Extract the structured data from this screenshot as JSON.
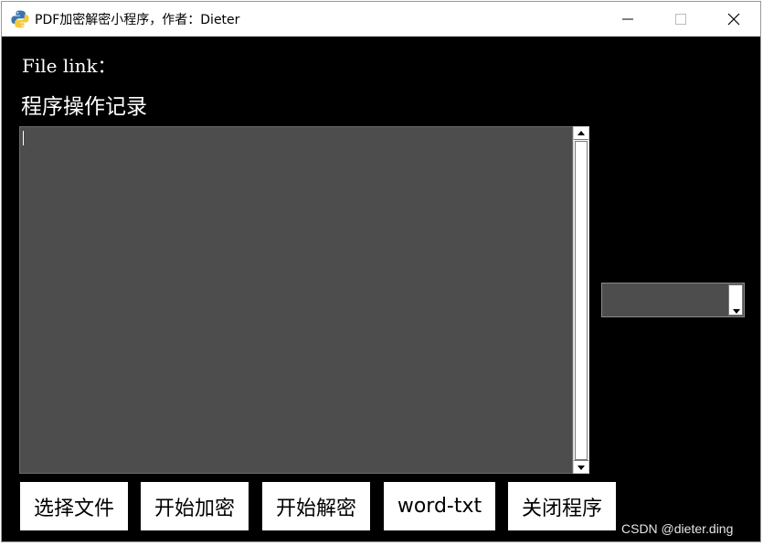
{
  "window": {
    "title": "PDF加密解密小程序，作者：Dieter",
    "icon": "python-icon"
  },
  "labels": {
    "file_link": "File link：",
    "log_title": "程序操作记录"
  },
  "log": {
    "value": ""
  },
  "combo": {
    "value": ""
  },
  "buttons": {
    "select_file": "选择文件",
    "start_encrypt": "开始加密",
    "start_decrypt": "开始解密",
    "word_txt": "word-txt",
    "close_program": "关闭程序"
  },
  "watermark": "CSDN @dieter.ding",
  "colors": {
    "background": "#000000",
    "panel": "#4d4d4d",
    "button": "#ffffff"
  }
}
